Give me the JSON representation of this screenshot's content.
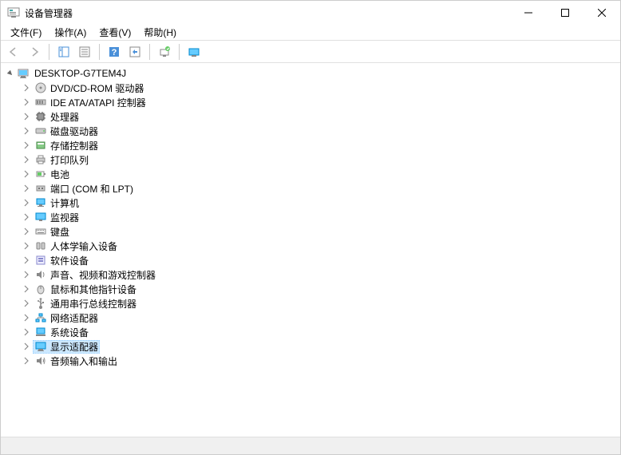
{
  "window": {
    "title": "设备管理器"
  },
  "menu": {
    "file": "文件(F)",
    "action": "操作(A)",
    "view": "查看(V)",
    "help": "帮助(H)"
  },
  "tree": {
    "root": "DESKTOP-G7TEM4J",
    "items": [
      "DVD/CD-ROM 驱动器",
      "IDE ATA/ATAPI 控制器",
      "处理器",
      "磁盘驱动器",
      "存储控制器",
      "打印队列",
      "电池",
      "端口 (COM 和 LPT)",
      "计算机",
      "监视器",
      "键盘",
      "人体学输入设备",
      "软件设备",
      "声音、视频和游戏控制器",
      "鼠标和其他指针设备",
      "通用串行总线控制器",
      "网络适配器",
      "系统设备",
      "显示适配器",
      "音频输入和输出"
    ],
    "selectedIndex": 18,
    "icons": [
      "disc",
      "ide",
      "cpu",
      "disk",
      "storage",
      "printer",
      "battery",
      "port",
      "computer",
      "monitor",
      "keyboard",
      "hid",
      "software",
      "sound",
      "mouse",
      "usb",
      "network",
      "system",
      "display",
      "audio"
    ]
  }
}
